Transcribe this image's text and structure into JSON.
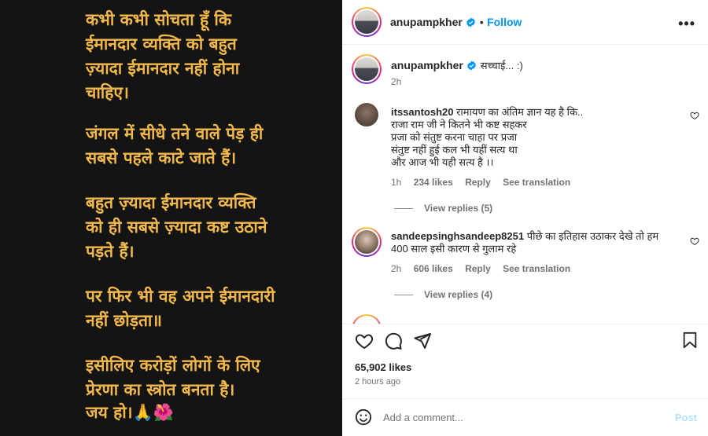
{
  "image_text": [
    "कभी कभी सोचता हूँ कि",
    "ईमानदार व्यक्ति को बहुत",
    "ज़्यादा ईमानदार नहीं होना",
    "चाहिए।",
    "जंगल में सीधे तने वाले पेड़ ही",
    "सबसे पहले काटे जाते हैं।",
    "बहुत ज़्यादा ईमानदार व्यक्ति",
    "को ही सबसे ज़्यादा कष्ट उठाने",
    "पड़ते हैं।",
    "पर फिर भी वह अपने ईमानदारी",
    "नहीं छोड़ता॥",
    "इसीलिए करोड़ों लोगों के लिए",
    "प्रेरणा का स्त्रोत बनता है।",
    "जय हो।🙏🌺"
  ],
  "header": {
    "username": "anupampkher",
    "separator": "•",
    "follow_label": "Follow",
    "more": "•••"
  },
  "caption": {
    "username": "anupampkher",
    "text": "सच्चाई... :)",
    "time": "2h"
  },
  "comments": [
    {
      "username": "itssantosh20",
      "lines": [
        "रामायण का अंतिम ज्ञान यह है कि..",
        "राजा राम जी ने कितने भी कष्ट सहकर",
        "प्रजा को संतुष्ट करना चाहा पर प्रजा",
        "संतुष्ट नहीं हुई कल भी यहीं सत्य था",
        "और आज भी यही सत्य है ।।"
      ],
      "time": "1h",
      "likes": "234 likes",
      "reply": "Reply",
      "translate": "See translation",
      "view_replies": "View replies (5)"
    },
    {
      "username": "sandeepsinghsandeep8251",
      "lines": [
        "पीछे का इतिहास उठाकर देखे तो हम",
        "400 साल इसी कारण से गुलाम रहे"
      ],
      "time": "2h",
      "likes": "606 likes",
      "reply": "Reply",
      "translate": "See translation",
      "view_replies": "View replies (4)"
    }
  ],
  "likes_count": "65,902 likes",
  "posted_ago": "2 hours ago",
  "add_comment": {
    "placeholder": "Add a comment...",
    "post_label": "Post"
  },
  "colors": {
    "quote_text": "#f2b84b",
    "image_bg": "#141414",
    "follow": "#0095f6",
    "post_disabled": "#b2dffc"
  },
  "icons": [
    "verified-badge-icon",
    "heart-icon",
    "comment-icon",
    "share-icon",
    "save-icon",
    "emoji-icon",
    "more-icon"
  ]
}
